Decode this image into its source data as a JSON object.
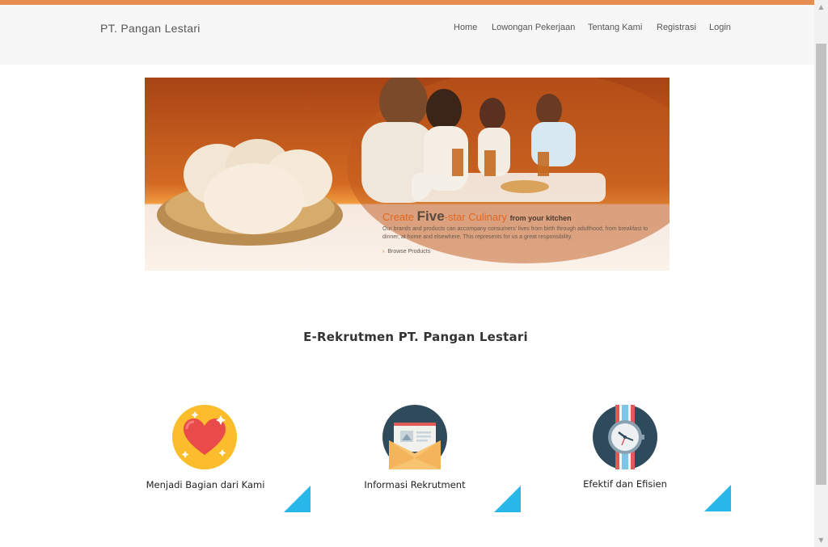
{
  "header": {
    "brand": "PT. Pangan Lestari",
    "nav": [
      "Home",
      "Lowongan Pekerjaan",
      "Tentang Kami",
      "Registrasi",
      "Login"
    ]
  },
  "banner": {
    "headline_part1": "Create ",
    "headline_big": "Five",
    "headline_part2": "-star Culinary ",
    "headline_small": "from your kitchen",
    "description": "Our brands and products can accompany consumers' lives from birth through adulthood, from breakfast to dinner, at home and elsewhere. This represents for us a great responsibility.",
    "link": "Browse Products"
  },
  "section_title": "E-Rekrutmen PT. Pangan Lestari",
  "features": [
    {
      "label": "Menjadi Bagian dari Kami",
      "icon": "heart-icon"
    },
    {
      "label": "Informasi Rekrutment",
      "icon": "envelope-icon"
    },
    {
      "label": "Efektif dan Efisien",
      "icon": "watch-icon"
    }
  ],
  "colors": {
    "top_accent": "#e98d4e",
    "corner_accent": "#29b6e8",
    "heart_bg": "#fbbd2c",
    "envelope_bg": "#2f4a5b",
    "watch_bg": "#2f4a5b"
  }
}
